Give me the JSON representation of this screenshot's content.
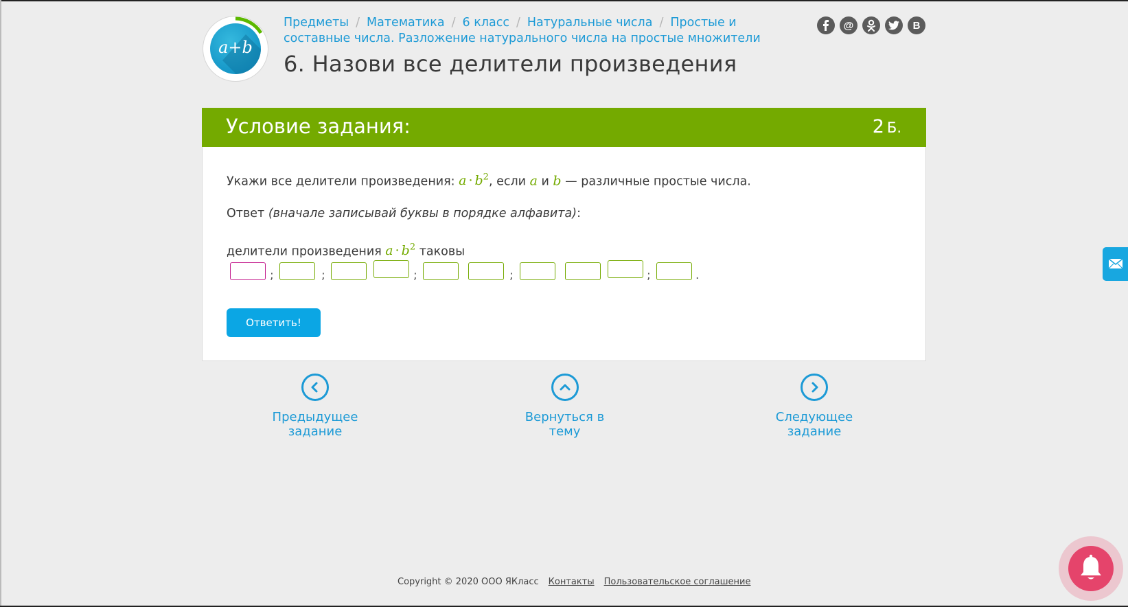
{
  "logo": {
    "text": "a+b"
  },
  "breadcrumbs": [
    "Предметы",
    "Математика",
    "6 класс",
    "Натуральные числа",
    "Простые и составные числа. Разложение натурального числа на простые множители"
  ],
  "page_title": "6. Назови все делители произведения",
  "social": [
    {
      "icon": "facebook-icon",
      "glyph": "f"
    },
    {
      "icon": "mailru-icon",
      "glyph": "@"
    },
    {
      "icon": "odnoklassniki-icon",
      "glyph": "ok"
    },
    {
      "icon": "twitter-icon",
      "glyph": "tw"
    },
    {
      "icon": "vkontakte-icon",
      "glyph": "B"
    }
  ],
  "task": {
    "header": "Условие задания:",
    "points_value": "2",
    "points_unit": "Б.",
    "q1_prefix": "Укажи все делители произведения: ",
    "q1_mid": ", если ",
    "q1_and": " и ",
    "q1_suffix": " — различные простые числа.",
    "answer_label": "Ответ ",
    "answer_hint": "(вначале записывай буквы в порядке алфавита)",
    "answer_colon": ":",
    "divisors_prefix": "делители произведения ",
    "divisors_suffix": " таковы",
    "var_a": "a",
    "var_b": "b",
    "exponent": "2",
    "separator": ";",
    "period": ".",
    "submit_label": "Ответить!"
  },
  "nav": {
    "prev": "Предыдущее задание",
    "back": "Вернуться в тему",
    "next": "Следующее задание"
  },
  "footer": {
    "copyright": "Copyright © 2020 ООО ЯКласс",
    "contacts": "Контакты",
    "agreement": "Пользовательское соглашение"
  },
  "colors": {
    "accent_green": "#74aa00",
    "link_blue": "#1c9ad6",
    "button_blue": "#0ba6e4",
    "bell_pink": "#e5446b"
  }
}
